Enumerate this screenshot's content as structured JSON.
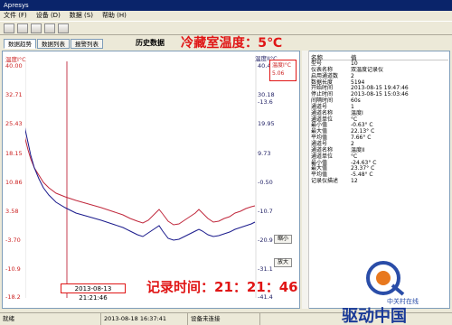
{
  "window": {
    "title": "Apresys"
  },
  "menu": [
    "文件 (F)",
    "设备 (D)",
    "数据 (S)",
    "帮助 (H)"
  ],
  "tabs": [
    "数据趋势",
    "数据列表",
    "报警列表"
  ],
  "history_title": "历史数据",
  "overlay_temperature": "冷藏室温度：5℃",
  "plot": {
    "left_title": "温度I°C",
    "right_title": "温度II°C",
    "left_ticks": [
      "40.00",
      "32.71",
      "25.43",
      "18.15",
      "10.86",
      "3.58",
      "-3.70",
      "-10.9",
      "-18.2"
    ],
    "right_ticks": [
      "40.41",
      "30.18",
      "19.95",
      "9.73",
      "-0.50",
      "-10.7",
      "-20.9",
      "-31.1",
      "-41.4"
    ],
    "right_extra": "-13.6",
    "readout_label": "温度I°C",
    "readout_value": "5.06",
    "zoom_out_label": "缩小",
    "zoom_in_label": "放大",
    "cursor_time": "2013-08-13 21:21:46",
    "colors": {
      "series1": "#c0283c",
      "series2": "#1a1a8c",
      "cursor": "#c0283c"
    }
  },
  "overlay_record_time": "记录时间：21：21：46",
  "info": {
    "header": [
      "名称",
      "值"
    ],
    "rows": [
      [
        "型号",
        "10"
      ],
      [
        "仪表名称",
        "双温度记录仪"
      ],
      [
        "启用通道数",
        "2"
      ],
      [
        "数据长度",
        "5194"
      ],
      [
        "开始时间",
        "2013-08-15 19:47:46"
      ],
      [
        "停止时间",
        "2013-08-15 15:03:46"
      ],
      [
        "间隔时间",
        "60s"
      ],
      [
        "通道号",
        "1"
      ],
      [
        "通道名称",
        "温度I"
      ],
      [
        "通道单位",
        "°C"
      ],
      [
        "最小值",
        "-0.63° C"
      ],
      [
        "最大值",
        "22.13° C"
      ],
      [
        "平均值",
        "7.66° C"
      ],
      [
        "通道号",
        "2"
      ],
      [
        "通道名称",
        "温度II"
      ],
      [
        "通道单位",
        "°C"
      ],
      [
        "最小值",
        "-24.63° C"
      ],
      [
        "最大值",
        "23.37° C"
      ],
      [
        "平均值",
        "-5.48° C"
      ],
      [
        "记录仪描述",
        "12"
      ]
    ]
  },
  "status": {
    "state": "就绪",
    "time": "2013-08-18 16:37:41",
    "device": "设备未连接"
  },
  "logo": {
    "text_big": "驱动中国",
    "text_small": "中关村在线"
  }
}
